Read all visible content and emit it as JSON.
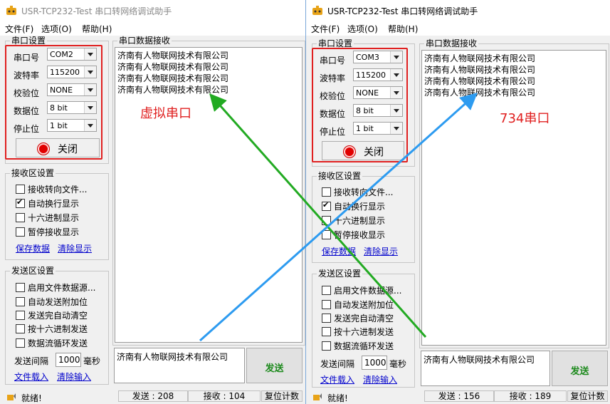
{
  "colors": {
    "annotation_red": "#e02020",
    "arrow_green": "#22aa22",
    "arrow_blue": "#2d9bf0",
    "send_green": "#1d8a1d",
    "link_blue": "#0000cc"
  },
  "windows": [
    {
      "title": "USR-TCP232-Test 串口转网络调试助手",
      "menu": [
        "文件(F)",
        "选项(O)",
        "帮助(H)"
      ],
      "serial_group_title": "串口设置",
      "serial_settings": [
        {
          "label": "串口号",
          "value": "COM2"
        },
        {
          "label": "波特率",
          "value": "115200"
        },
        {
          "label": "校验位",
          "value": "NONE"
        },
        {
          "label": "数据位",
          "value": "8 bit"
        },
        {
          "label": "停止位",
          "value": "1 bit"
        }
      ],
      "close_button": "关闭",
      "receive_group_title": "接收区设置",
      "receive_options": [
        {
          "label": "接收转向文件...",
          "checked": false
        },
        {
          "label": "自动换行显示",
          "checked": true
        },
        {
          "label": "十六进制显示",
          "checked": false
        },
        {
          "label": "暂停接收显示",
          "checked": false
        }
      ],
      "receive_links": [
        "保存数据",
        "清除显示"
      ],
      "send_group_title": "发送区设置",
      "send_options": [
        {
          "label": "启用文件数据源...",
          "checked": false
        },
        {
          "label": "自动发送附加位",
          "checked": false
        },
        {
          "label": "发送完自动清空",
          "checked": false
        },
        {
          "label": "按十六进制发送",
          "checked": false
        },
        {
          "label": "数据流循环发送",
          "checked": false
        }
      ],
      "interval_label": "发送间隔",
      "interval_value": "1000",
      "interval_unit": "毫秒",
      "send_links": [
        "文件载入",
        "清除输入"
      ],
      "recv_title": "串口数据接收",
      "recv_lines": [
        "济南有人物联网技术有限公司",
        "济南有人物联网技术有限公司",
        "济南有人物联网技术有限公司",
        "济南有人物联网技术有限公司"
      ],
      "send_text": "济南有人物联网技术有限公司",
      "send_button": "发送",
      "status_ready": "就绪!",
      "status_sent": "发送 : 208",
      "status_recv": "接收 : 104",
      "reset_button": "复位计数",
      "annotation": "虚拟串口"
    },
    {
      "title": "USR-TCP232-Test 串口转网络调试助手",
      "menu": [
        "文件(F)",
        "选项(O)",
        "帮助(H)"
      ],
      "serial_group_title": "串口设置",
      "serial_settings": [
        {
          "label": "串口号",
          "value": "COM3"
        },
        {
          "label": "波特率",
          "value": "115200"
        },
        {
          "label": "校验位",
          "value": "NONE"
        },
        {
          "label": "数据位",
          "value": "8 bit"
        },
        {
          "label": "停止位",
          "value": "1 bit"
        }
      ],
      "close_button": "关闭",
      "receive_group_title": "接收区设置",
      "receive_options": [
        {
          "label": "接收转向文件...",
          "checked": false
        },
        {
          "label": "自动换行显示",
          "checked": true
        },
        {
          "label": "十六进制显示",
          "checked": false
        },
        {
          "label": "暂停接收显示",
          "checked": false
        }
      ],
      "receive_links": [
        "保存数据",
        "清除显示"
      ],
      "send_group_title": "发送区设置",
      "send_options": [
        {
          "label": "启用文件数据源...",
          "checked": false
        },
        {
          "label": "自动发送附加位",
          "checked": false
        },
        {
          "label": "发送完自动清空",
          "checked": false
        },
        {
          "label": "按十六进制发送",
          "checked": false
        },
        {
          "label": "数据流循环发送",
          "checked": false
        }
      ],
      "interval_label": "发送间隔",
      "interval_value": "1000",
      "interval_unit": "毫秒",
      "send_links": [
        "文件载入",
        "清除输入"
      ],
      "recv_title": "串口数据接收",
      "recv_lines": [
        "济南有人物联网技术有限公司",
        "济南有人物联网技术有限公司",
        "济南有人物联网技术有限公司",
        "济南有人物联网技术有限公司"
      ],
      "send_text": "济南有人物联网技术有限公司",
      "send_button": "发送",
      "status_ready": "就绪!",
      "status_sent": "发送 : 156",
      "status_recv": "接收 : 189",
      "reset_button": "复位计数",
      "annotation": "734串口"
    }
  ]
}
